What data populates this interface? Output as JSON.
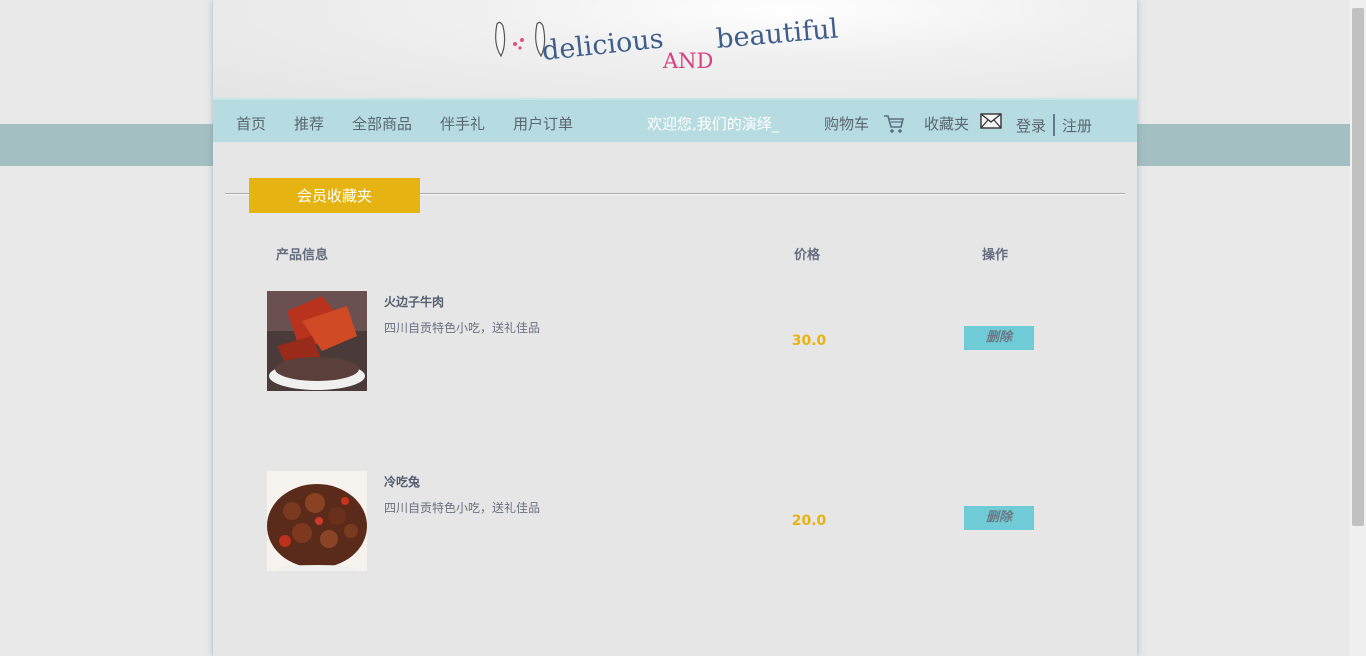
{
  "logo": {
    "word1": "delicious",
    "word2": "AND",
    "word3": "beautiful"
  },
  "nav": {
    "items": [
      "首页",
      "推荐",
      "全部商品",
      "伴手礼",
      "用户订单"
    ],
    "welcome": "欢迎您,我们的演绎_",
    "cart_label": "购物车",
    "favorites_label": "收藏夹",
    "login_label": "登录",
    "register_label": "注册"
  },
  "section": {
    "title": "会员收藏夹"
  },
  "table": {
    "headers": {
      "product": "产品信息",
      "price": "价格",
      "action": "操作"
    },
    "rows": [
      {
        "name": "火边子牛肉",
        "desc": "四川自贡特色小吃，送礼佳品",
        "price": "30.0",
        "action": "删除"
      },
      {
        "name": "冷吃兔",
        "desc": "四川自贡特色小吃，送礼佳品",
        "price": "20.0",
        "action": "删除"
      }
    ]
  },
  "colors": {
    "accent": "#e6b412",
    "nav_bg": "#b6dbe0",
    "band": "#a3bfc1",
    "delete_btn": "#6fcbd6"
  },
  "icons": {
    "cart": "cart-icon",
    "favorites": "envelope-icon"
  }
}
